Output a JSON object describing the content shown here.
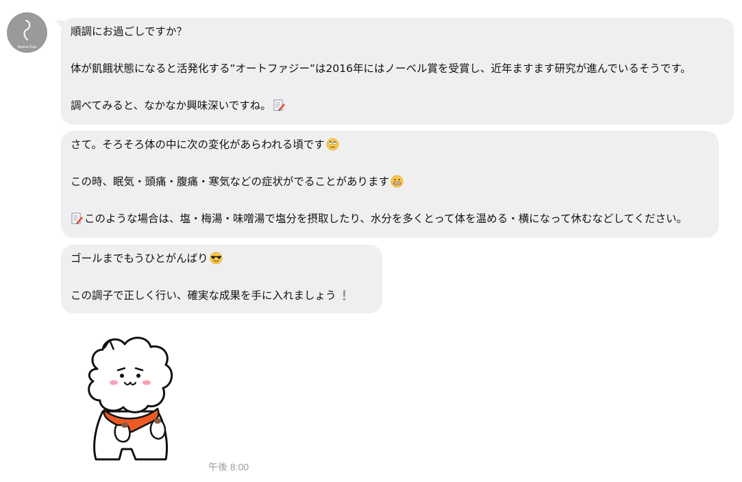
{
  "sender": {
    "avatar_text": "Remer-Eau"
  },
  "messages": [
    {
      "lines": [
        "順調にお過ごしですか？",
        "体が飢餓状態になると活発化する”オートファジー”は2016年にはノーベル賞を受賞し、近年ますます研究が進んでいるそうです。",
        "調べてみると、なかなか興味深いですね。"
      ],
      "emojis": [
        "memo-emoji"
      ]
    },
    {
      "lines": [
        "さて。そろそろ体の中に次の変化があらわれる頃です",
        "この時、眠気・頭痛・腹痛・寒気などの症状がでることがあります",
        "このような場合は、塩・梅湯・味噌湯で塩分を摂取したり、水分を多くとって体を温める・横になって休むなどしてください。"
      ],
      "emojis": [
        "eye-roll-emoji",
        "grimace-emoji",
        "memo-emoji"
      ]
    },
    {
      "lines": [
        "ゴールまでもうひとがんばり",
        "この調子で正しく行い、確実な成果を手に入れましょう"
      ],
      "emojis": [
        "sunglasses-emoji",
        "exclamation-emoji"
      ]
    }
  ],
  "sticker": {
    "name": "white-fluffy-character-sticker"
  },
  "timestamp": "午後 8:00",
  "colors": {
    "bubble": "#efefef",
    "timestamp": "#9b9b9b",
    "avatar": "#9a9a9a"
  }
}
